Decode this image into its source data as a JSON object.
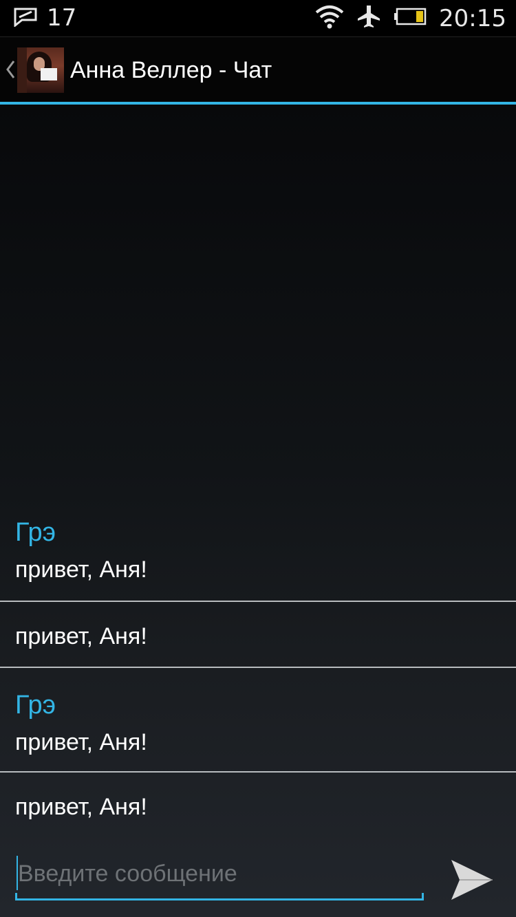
{
  "status_bar": {
    "notification_count": "17",
    "time": "20:15",
    "icons": [
      "message-icon",
      "wifi-icon",
      "airplane-mode-icon",
      "battery-icon"
    ]
  },
  "header": {
    "back_icon": "chevron-left-icon",
    "title": "Анна Веллер - Чат"
  },
  "messages": [
    {
      "sender": "Грэ",
      "text": "привет, Аня!"
    },
    {
      "sender": "",
      "text": "привет, Аня!"
    },
    {
      "sender": "Грэ",
      "text": "привет, Аня!"
    },
    {
      "sender": "",
      "text": "привет, Аня!"
    }
  ],
  "composer": {
    "placeholder": "Введите сообщение",
    "value": "",
    "send_icon": "send-icon"
  },
  "colors": {
    "accent": "#33b5e5",
    "background_top": "#08090b",
    "background_bottom": "#22262c",
    "separator": "#b9bcbf"
  }
}
